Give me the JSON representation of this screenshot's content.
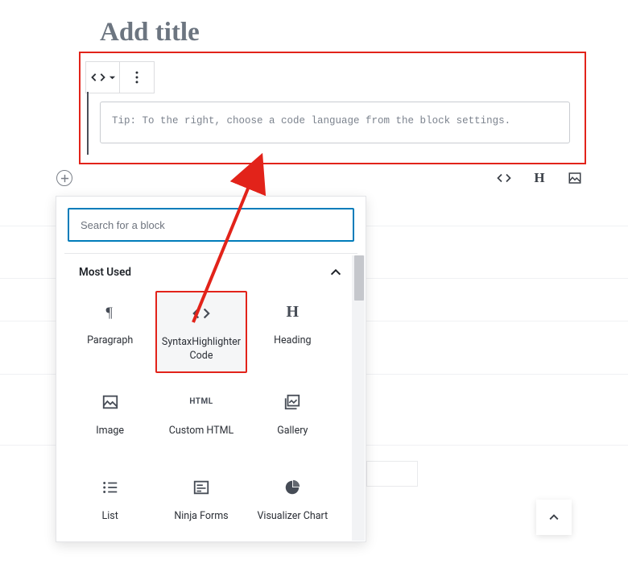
{
  "title_placeholder": "Add title",
  "code_block": {
    "tip_text": "Tip: To the right, choose a code language from the block settings."
  },
  "inserter": {
    "search_placeholder": "Search for a block",
    "section_title": "Most Used",
    "blocks": [
      {
        "label": "Paragraph"
      },
      {
        "label": "SyntaxHighlighter Code"
      },
      {
        "label": "Heading"
      },
      {
        "label": "Image"
      },
      {
        "label": "Custom HTML"
      },
      {
        "label": "Gallery"
      },
      {
        "label": "List"
      },
      {
        "label": "Ninja Forms"
      },
      {
        "label": "Visualizer Chart"
      }
    ]
  }
}
